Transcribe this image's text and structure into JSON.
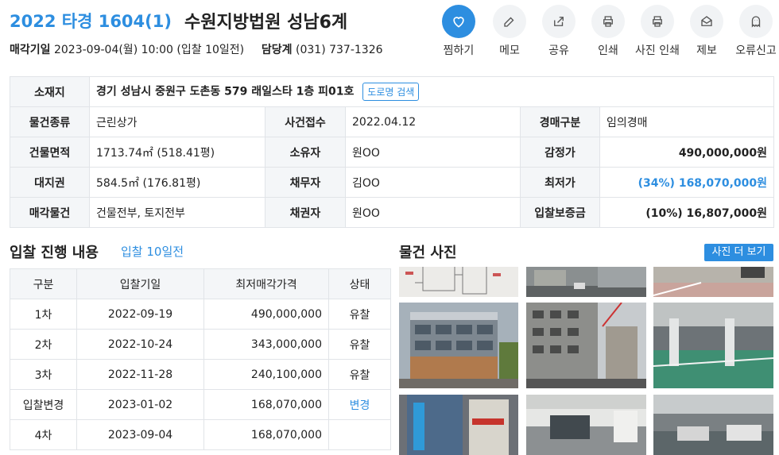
{
  "header": {
    "case_no": "2022 타경 1604(1)",
    "court": "수원지방법원 성남6계",
    "sale_date_label": "매각기일",
    "sale_date": "2023-09-04(월) 10:00 (입찰 10일전)",
    "dept_label": "담당계",
    "dept_phone": "(031) 737-1326"
  },
  "actions": [
    {
      "label": "찜하기"
    },
    {
      "label": "메모"
    },
    {
      "label": "공유"
    },
    {
      "label": "인쇄"
    },
    {
      "label": "사진 인쇄"
    },
    {
      "label": "제보"
    },
    {
      "label": "오류신고"
    }
  ],
  "info": {
    "location_label": "소재지",
    "location": "경기 성남시 중원구 도촌동 579 래일스타 1층 피01호",
    "road_button": "도로명 검색",
    "rows": [
      {
        "l1": "물건종류",
        "v1": "근린상가",
        "l2": "사건접수",
        "v2": "2022.04.12",
        "l3": "경매구분",
        "v3": "임의경매"
      },
      {
        "l1": "건물면적",
        "v1": "1713.74㎡ (518.41평)",
        "l2": "소유자",
        "v2": "원OO",
        "l3": "감정가",
        "v3": "490,000,000원"
      },
      {
        "l1": "대지권",
        "v1": "584.5㎡ (176.81평)",
        "l2": "채무자",
        "v2": "김OO",
        "l3": "최저가",
        "v3": "(34%) 168,070,000원"
      },
      {
        "l1": "매각물건",
        "v1": "건물전부, 토지전부",
        "l2": "채권자",
        "v2": "원OO",
        "l3": "입찰보증금",
        "v3": "(10%) 16,807,000원"
      }
    ]
  },
  "bidding": {
    "title": "입찰 진행 내용",
    "subtitle": "입찰 10일전",
    "headers": [
      "구분",
      "입찰기일",
      "최저매각가격",
      "상태"
    ],
    "rows": [
      {
        "round": "1차",
        "date": "2022-09-19",
        "price": "490,000,000",
        "status": "유찰"
      },
      {
        "round": "2차",
        "date": "2022-10-24",
        "price": "343,000,000",
        "status": "유찰"
      },
      {
        "round": "3차",
        "date": "2022-11-28",
        "price": "240,100,000",
        "status": "유찰"
      },
      {
        "round": "입찰변경",
        "date": "2023-01-02",
        "price": "168,070,000",
        "status": "변경"
      },
      {
        "round": "4차",
        "date": "2023-09-04",
        "price": "168,070,000",
        "status": ""
      }
    ]
  },
  "photos": {
    "title": "물건 사진",
    "more_button": "사진 더 보기",
    "items": [
      {
        "name": "floor-plan-photo"
      },
      {
        "name": "street-photo"
      },
      {
        "name": "parking-entrance-photo"
      },
      {
        "name": "building-exterior-photo"
      },
      {
        "name": "building-side-photo"
      },
      {
        "name": "parking-garage-photo"
      },
      {
        "name": "shop-sign-photo"
      },
      {
        "name": "building-entrance-photo"
      },
      {
        "name": "underground-parking-photo"
      }
    ]
  },
  "colors": {
    "accent": "#2d8ee0",
    "header_bg": "#f4f6f8",
    "border": "#e1e4e8"
  }
}
